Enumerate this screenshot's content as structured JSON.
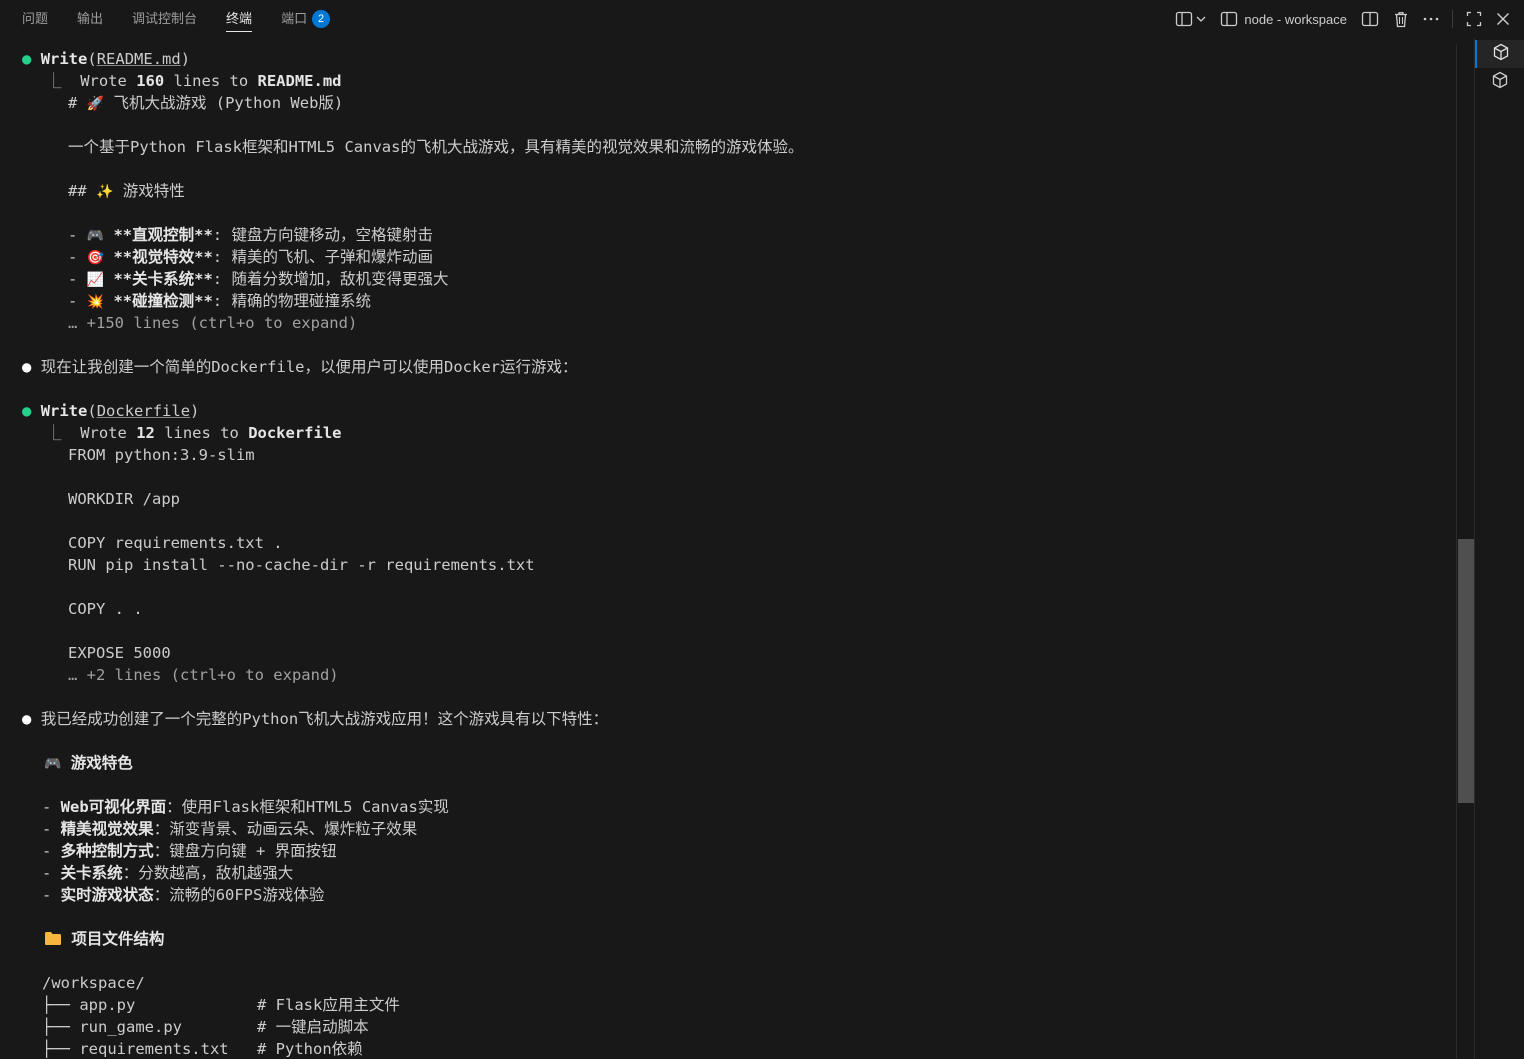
{
  "panel": {
    "tabs": [
      {
        "label": "问题"
      },
      {
        "label": "输出"
      },
      {
        "label": "调试控制台"
      },
      {
        "label": "终端",
        "active": true
      },
      {
        "label": "端口",
        "badge": "2"
      }
    ],
    "terminal_name": "node - workspace",
    "icons": [
      "split-layout-icon",
      "chevron-down-icon",
      "terminal-panel-icon",
      "split-terminal-icon",
      "trash-icon",
      "more-icon",
      "maximize-icon",
      "close-icon"
    ],
    "accent": "#0078d4"
  },
  "terminal": {
    "w1_tool": "Write",
    "w1_arg": "README.md",
    "w1_wrote_pre": "Wrote ",
    "w1_count": "160",
    "w1_mid": " lines to ",
    "w1_file": "README.md",
    "md_h1_hash": "# ",
    "md_h1_emoji": "🚀",
    "md_h1_text": " 飞机大战游戏 (Python Web版)",
    "md_desc": "一个基于Python Flask框架和HTML5 Canvas的飞机大战游戏，具有精美的视觉效果和流畅的游戏体验。",
    "md_h2_hash": "## ",
    "md_h2_emoji": "✨",
    "md_h2_text": " 游戏特性",
    "md_items": [
      {
        "emoji": "🎮",
        "bold": "**直观控制**",
        "text": ": 键盘方向键移动，空格键射击"
      },
      {
        "emoji": "🎯",
        "bold": "**视觉特效**",
        "text": ": 精美的飞机、子弹和爆炸动画"
      },
      {
        "emoji": "📈",
        "bold": "**关卡系统**",
        "text": ": 随着分数增加，敌机变得更强大"
      },
      {
        "emoji": "💥",
        "bold": "**碰撞检测**",
        "text": ": 精确的物理碰撞系统"
      }
    ],
    "w1_more": "… +150 lines (ctrl+o to expand)",
    "msg1": "现在让我创建一个简单的Dockerfile，以便用户可以使用Docker运行游戏：",
    "w2_tool": "Write",
    "w2_arg": "Dockerfile",
    "w2_wrote_pre": "Wrote ",
    "w2_count": "12",
    "w2_mid": " lines to ",
    "w2_file": "Dockerfile",
    "docker_lines": {
      "from": "FROM python:3.9-slim",
      "workdir": "WORKDIR /app",
      "copy_req": "COPY requirements.txt .",
      "run": "RUN pip install --no-cache-dir -r requirements.txt",
      "copy_all": "COPY . .",
      "expose": "EXPOSE 5000"
    },
    "w2_more": "… +2 lines (ctrl+o to expand)",
    "msg2": "我已经成功创建了一个完整的Python飞机大战游戏应用！这个游戏具有以下特性：",
    "sec1_emoji": "🎮",
    "sec1_title": "游戏特色",
    "features": [
      {
        "bold": "Web可视化界面",
        "text": "：使用Flask框架和HTML5 Canvas实现"
      },
      {
        "bold": "精美视觉效果",
        "text": "：渐变背景、动画云朵、爆炸粒子效果"
      },
      {
        "bold": "多种控制方式",
        "text": "：键盘方向键 + 界面按钮"
      },
      {
        "bold": "关卡系统",
        "text": "：分数越高，敌机越强大"
      },
      {
        "bold": "实时游戏状态",
        "text": "：流畅的60FPS游戏体验"
      }
    ],
    "sec2_title": "项目文件结构",
    "tree_root": "/workspace/",
    "tree": [
      {
        "prefix": "├── ",
        "name": "app.py",
        "comment": "# Flask应用主文件"
      },
      {
        "prefix": "├── ",
        "name": "run_game.py",
        "comment": "# 一键启动脚本"
      },
      {
        "prefix": "├── ",
        "name": "requirements.txt",
        "comment": "# Python依赖"
      }
    ],
    "bullet_green": "●",
    "bullet_white": "●",
    "elbow": "⎿",
    "dash": "- "
  },
  "sidebar": {
    "items": [
      "terminal-node-icon",
      "terminal-node-icon"
    ]
  }
}
